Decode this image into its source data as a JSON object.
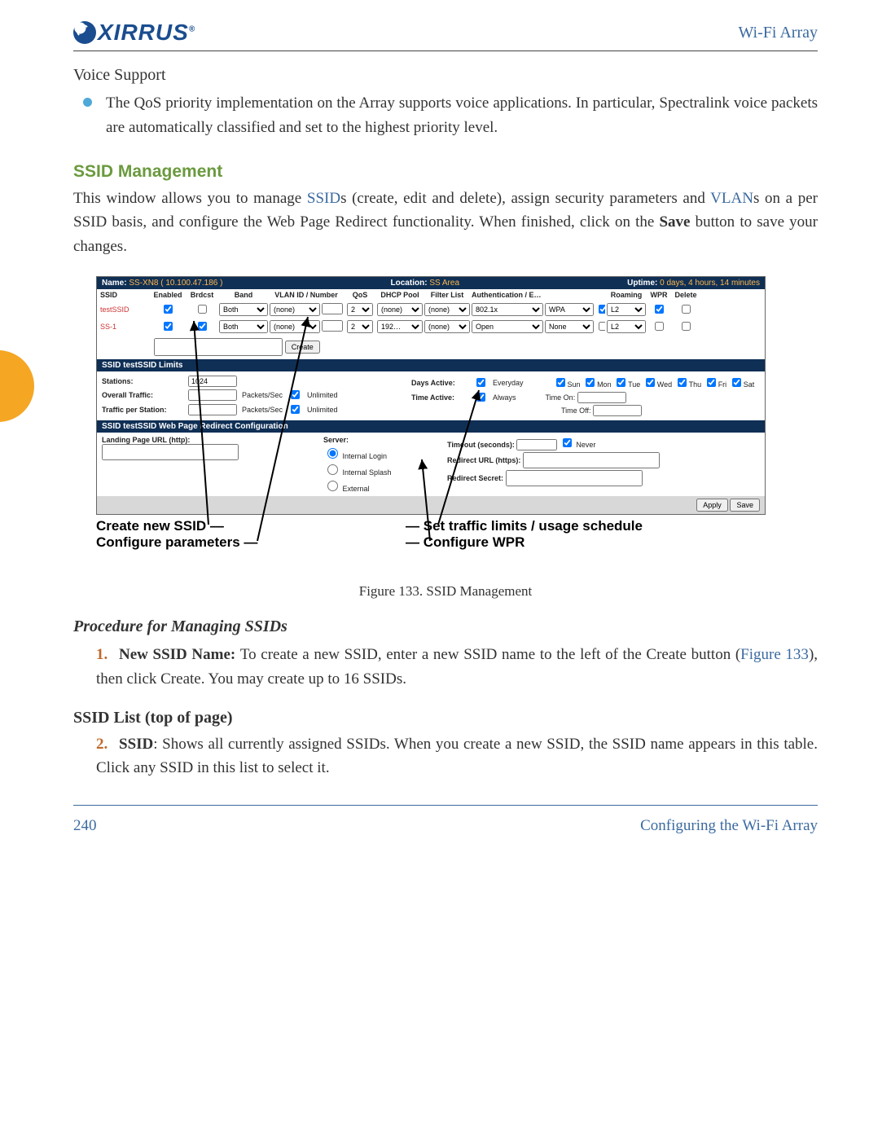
{
  "header": {
    "product": "Wi-Fi Array",
    "logo_text": "XIRRUS",
    "logo_reg": "®"
  },
  "voice": {
    "title": "Voice Support",
    "bullet": "The QoS priority implementation on the Array supports voice applications. In particular, Spectralink voice packets are automatically classified and set to the highest priority level."
  },
  "ssid_mgmt": {
    "heading": "SSID Management",
    "intro_pre": "This window allows you to manage ",
    "intro_link1": "SSID",
    "intro_mid1": "s (create, edit and delete), assign security parameters and ",
    "intro_link2": "VLAN",
    "intro_mid2": "s on a per SSID basis, and configure the Web Page Redirect functionality. When finished, click on the ",
    "intro_bold": "Save",
    "intro_post": " button to save your changes."
  },
  "screenshot": {
    "bar": {
      "name_lbl": "Name:",
      "name_val": "SS-XN8   ( 10.100.47.186 )",
      "loc_lbl": "Location:",
      "loc_val": "SS Area",
      "up_lbl": "Uptime:",
      "up_val": "0 days, 4 hours, 14 minutes"
    },
    "cols": [
      "SSID",
      "Enabled",
      "Brdcst",
      "Band",
      "VLAN ID / Number",
      "QoS",
      "DHCP Pool",
      "Filter List",
      "Authentication / Encryption / Global",
      "",
      "",
      "Roaming",
      "WPR",
      "Delete"
    ],
    "rows": [
      {
        "ssid": "testSSID",
        "enabled": true,
        "brdcst": false,
        "band": "Both",
        "vlan": "(none)",
        "vlan_num": "",
        "qos": "2",
        "dhcp": "(none)",
        "filter": "(none)",
        "auth": "802.1x",
        "enc": "WPA",
        "global": true,
        "roam": "L2",
        "wpr": true,
        "del": false
      },
      {
        "ssid": "SS-1",
        "enabled": true,
        "brdcst": true,
        "band": "Both",
        "vlan": "(none)",
        "vlan_num": "",
        "qos": "2",
        "dhcp": "192…",
        "filter": "(none)",
        "auth": "Open",
        "enc": "None",
        "global": false,
        "roam": "L2",
        "wpr": false,
        "del": false
      }
    ],
    "create_btn": "Create",
    "limits": {
      "title": "SSID testSSID Limits",
      "stations_lbl": "Stations:",
      "stations_val": "1024",
      "overall_lbl": "Overall Traffic:",
      "pps": "Packets/Sec",
      "unlimited": "Unlimited",
      "perstation_lbl": "Traffic per Station:",
      "days_lbl": "Days Active:",
      "everyday": "Everyday",
      "days": [
        "Sun",
        "Mon",
        "Tue",
        "Wed",
        "Thu",
        "Fri",
        "Sat"
      ],
      "time_lbl": "Time Active:",
      "always": "Always",
      "time_on": "Time On:",
      "time_off": "Time Off:"
    },
    "wpr": {
      "title": "SSID testSSID Web Page Redirect Configuration",
      "landing_lbl": "Landing Page URL (http):",
      "server_lbl": "Server:",
      "opts": [
        "Internal Login",
        "Internal Splash",
        "External"
      ],
      "timeout_lbl": "Timeout (seconds):",
      "never": "Never",
      "redirect_lbl": "Redirect URL (https):",
      "secret_lbl": "Redirect Secret:"
    },
    "apply": "Apply",
    "save": "Save"
  },
  "callouts": {
    "l1": "Create new SSID",
    "l2": "Configure parameters",
    "r1": "Set traffic limits / usage schedule",
    "r2": "Configure WPR"
  },
  "figure_caption": "Figure 133. SSID Management",
  "procedure_heading": "Procedure for Managing SSIDs",
  "step1": {
    "num": "1.",
    "lead": "New SSID Name: ",
    "pre": "To create a new SSID, enter a new SSID name to the left of the Create button (",
    "link": "Figure 133",
    "post": "), then click Create. You may create up to 16 SSIDs."
  },
  "list_heading": "SSID List (top of page)",
  "step2": {
    "num": "2.",
    "lead": "SSID",
    "text": ": Shows all currently assigned SSIDs. When you create a new SSID, the SSID name appears in this table. Click any SSID in this list to select it."
  },
  "footer": {
    "page": "240",
    "section": "Configuring the Wi-Fi Array"
  }
}
